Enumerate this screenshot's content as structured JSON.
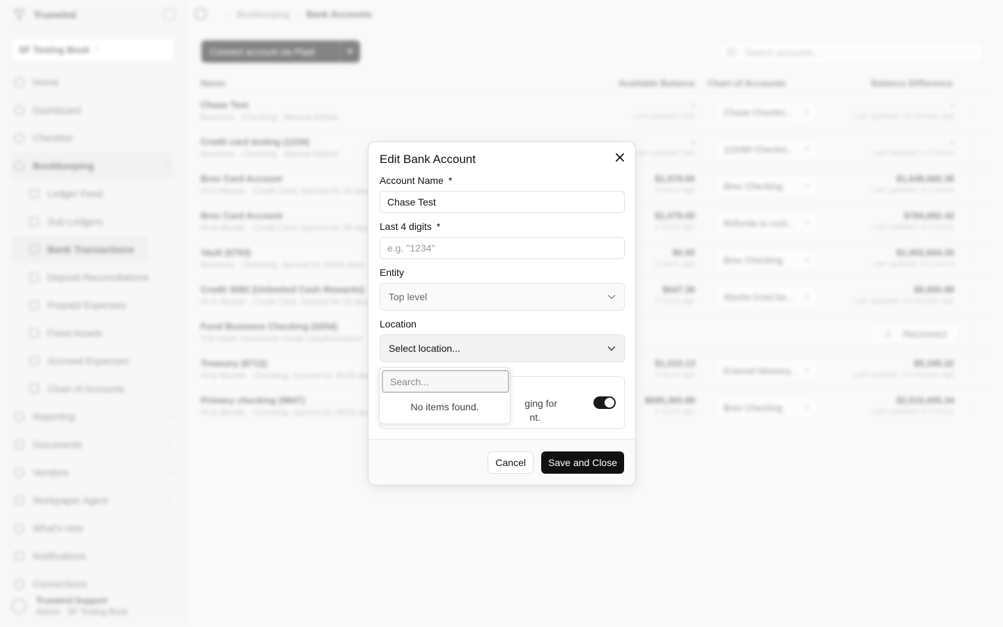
{
  "app": {
    "brand": "Truewind",
    "org": "SF Testing Book",
    "nav": [
      {
        "label": "Home"
      },
      {
        "label": "Dashboard"
      },
      {
        "label": "Checklist"
      }
    ],
    "bookkeeping": {
      "label": "Bookkeeping",
      "items": [
        "Ledger Feed",
        "Sub Ledgers",
        "Bank Transactions",
        "Deposit Reconciliations",
        "Prepaid Expenses",
        "Fixed Assets",
        "Accrued Expenses",
        "Chart of Accounts"
      ]
    },
    "nav2": [
      {
        "label": "Reporting"
      },
      {
        "label": "Documents"
      },
      {
        "label": "Vendors"
      },
      {
        "label": "Workpaper Agent"
      }
    ],
    "nav3": [
      {
        "label": "What's new"
      },
      {
        "label": "Notifications"
      },
      {
        "label": "Connections"
      }
    ],
    "footer": {
      "name": "Truewind Support",
      "sub": "Admin · SF Testing Book"
    }
  },
  "page": {
    "breadcrumb": [
      "Bookkeeping",
      "Bank Accounts"
    ],
    "connect_label": "Connect account via Plaid",
    "search_placeholder": "Search accounts...",
    "columns": {
      "name": "Name",
      "available": "Available Balance",
      "coa": "Chart of Accounts",
      "diff": "Balance Difference"
    },
    "rows": [
      {
        "name": "Chase Test",
        "sub": "Business · Checking · Manual Added",
        "bal": "-",
        "balsub": "Last updated: N/A",
        "coa": "Chase Checkin...",
        "diff": "-",
        "diffsub": "Last updated: 14 minutes ago"
      },
      {
        "name": "Credit card testing (1234)",
        "sub": "Business · Checking · Manual Added",
        "bal": "-",
        "balsub": "Last updated: N/A",
        "coa": "1234M Checkin...",
        "diff": "-",
        "diffsub": "Last updated: in 2 hours"
      },
      {
        "name": "Brex Card Account",
        "sub": "Hi to Mundo · Credit Card, Synced for 26 days",
        "bal": "$1,079.00",
        "balsub": "2 hours ago",
        "coa": "Brex Checking",
        "diff": "$1,648,682.38",
        "diffsub": "Last updated: in 2 hours"
      },
      {
        "name": "Brex Card Account",
        "sub": "Hi to Mundo · Credit Card, Synced for 26 days",
        "bal": "$1,079.00",
        "balsub": "2 hours ago",
        "coa": "Refunds to cust...",
        "diff": "$784,682.42",
        "diffsub": "Last updated: in 2 hours"
      },
      {
        "name": "Vault (6793)",
        "sub": "Business · Checking, Synced for 26/26 days",
        "bal": "$0.00",
        "balsub": "2 hours ago",
        "coa": "Brex Checking",
        "diff": "$1,002,844.35",
        "diffsub": "Last updated: in 2 hours"
      },
      {
        "name": "Credit 3082 (Unlimited Cash Rewards)",
        "sub": "Hi to Mundo · Credit Card, Synced for 26 days",
        "bal": "$647.38",
        "balsub": "2 hours ago",
        "coa": "Stocks (cost ba...",
        "diff": "$8,650.88",
        "diffsub": "Last updated: 14 minutes ago"
      },
      {
        "name": "Fund Business Checking (0254)",
        "sub": "This bank connection needs reauthorization",
        "reconnect": "Reconnect"
      },
      {
        "name": "Treasury (8712)",
        "sub": "Hi to Mundo · Checking, Synced for 26/26 days",
        "bal": "$1,010.13",
        "balsub": "2 hours ago",
        "coa": "Entered Memory...",
        "diff": "$5,345.22",
        "diffsub": "Last updated: 14 minutes ago"
      },
      {
        "name": "Primary checking (9847)",
        "sub": "Hi to Mundo · Checking, Synced for 26/26 days",
        "bal": "$695,360.88",
        "balsub": "2 hours ago",
        "coa": "Brex Checking",
        "diff": "$2,516,005.34",
        "diffsub": "Last updated: in 2 hours"
      }
    ]
  },
  "modal": {
    "title": "Edit Bank Account",
    "account_name": {
      "label": "Account Name",
      "required": "*",
      "value": "Chase Test"
    },
    "last4": {
      "label": "Last 4 digits",
      "required": "*",
      "placeholder": "e.g. \"1234\""
    },
    "entity": {
      "label": "Entity",
      "value": "Top level"
    },
    "location": {
      "label": "Location",
      "value": "Select location..."
    },
    "toggle": {
      "text_line1": "ging for",
      "text_line2": "nt.",
      "on": true
    },
    "cancel_label": "Cancel",
    "save_label": "Save and Close",
    "dropdown": {
      "search_placeholder": "Search...",
      "empty_text": "No items found."
    }
  }
}
